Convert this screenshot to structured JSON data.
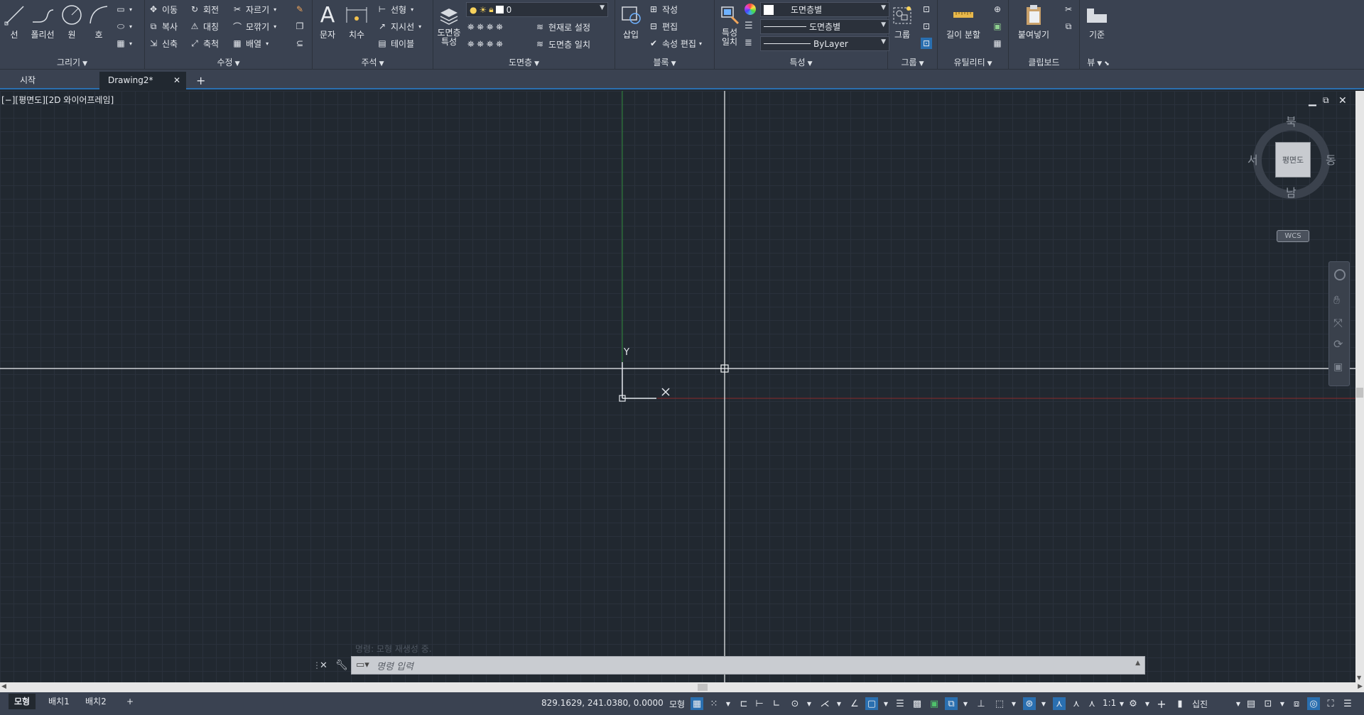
{
  "ribbon": {
    "draw": {
      "title": "그리기",
      "line": "선",
      "polyline": "폴리선",
      "circle": "원",
      "arc": "호"
    },
    "modify": {
      "title": "수정",
      "move": "이동",
      "rotate": "회전",
      "trim": "자르기",
      "copy": "복사",
      "mirror": "대칭",
      "fillet": "모깎기",
      "stretch": "신축",
      "scale": "축척",
      "array": "배열"
    },
    "annotation": {
      "title": "주석",
      "text": "문자",
      "dimension": "치수",
      "linear": "선형",
      "leader": "지시선",
      "table": "테이블"
    },
    "layers": {
      "title": "도면층",
      "properties_l1": "도면층",
      "properties_l2": "특성",
      "current_layer": "0",
      "make_current": "현재로 설정",
      "match_layer": "도면층 일치"
    },
    "block": {
      "title": "블록",
      "insert": "삽입",
      "create": "작성",
      "edit": "편집",
      "edit_attributes": "속성 편집"
    },
    "properties": {
      "title": "특성",
      "match_l1": "특성",
      "match_l2": "일치",
      "color": "도면층별",
      "linetype": "도면층별",
      "lineweight": "ByLayer"
    },
    "groups": {
      "title": "그룹",
      "group": "그룹"
    },
    "utilities": {
      "title": "유틸리티",
      "measure": "길이 분할"
    },
    "clipboard": {
      "title": "클립보드",
      "paste": "붙여넣기"
    },
    "view": {
      "title": "뷰",
      "base": "기준"
    }
  },
  "tabs": {
    "start": "시작",
    "drawing": "Drawing2*",
    "close": "✕",
    "add": "+"
  },
  "viewport": {
    "label": "[−][평면도][2D 와이어프레임]",
    "ucs_y": "Y",
    "ucs_x": "X",
    "viewcube": {
      "north": "북",
      "south": "남",
      "east": "동",
      "west": "서",
      "face": "평면도",
      "wcs": "WCS"
    }
  },
  "command": {
    "history": "명령: 모형 재생성 중.",
    "placeholder": "명령 입력"
  },
  "status": {
    "layout_tabs": [
      "모형",
      "배치1",
      "배치2"
    ],
    "add_layout": "+",
    "coordinates": "829.1629, 241.0380, 0.0000",
    "model_space": "모형",
    "scale": "1:1",
    "units": "십진"
  },
  "colors": {
    "ribbon_bg": "#3a4251",
    "canvas_bg": "#212830",
    "accent": "#2a6fb0"
  }
}
